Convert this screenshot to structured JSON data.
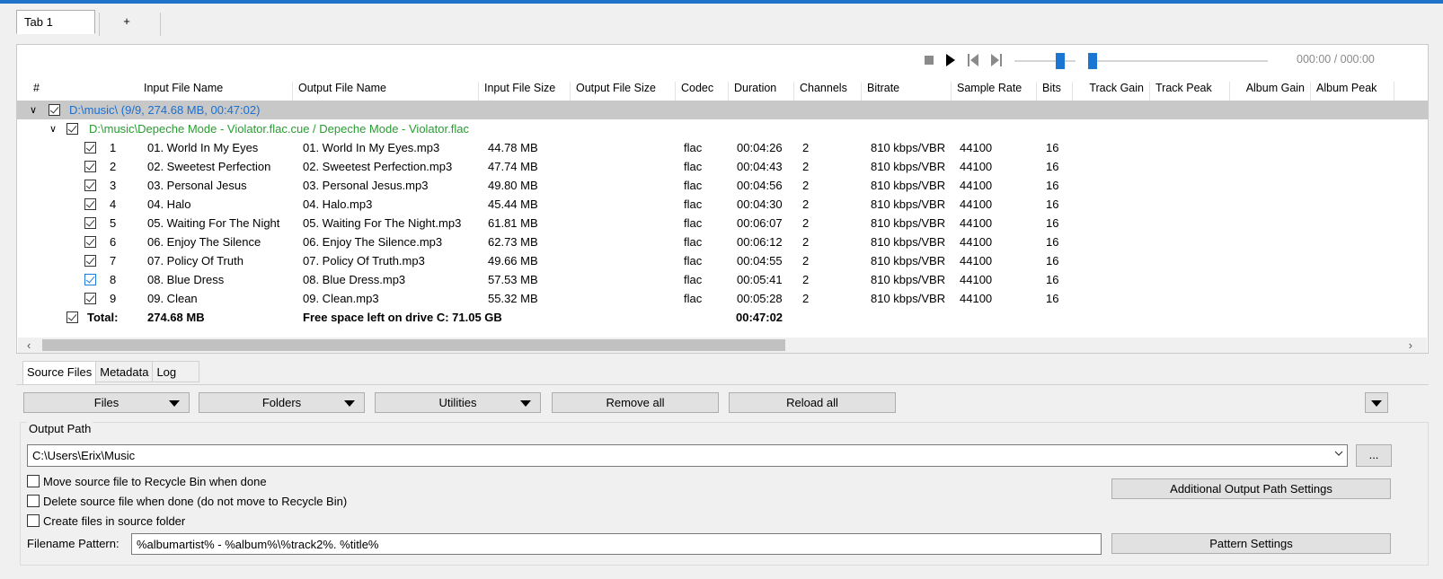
{
  "tabs": [
    "Tab 1",
    "+"
  ],
  "player": {
    "time": "000:00 / 000:00"
  },
  "columns": [
    "#",
    "Input File Name",
    "Output File Name",
    "Input File Size",
    "Output File Size",
    "Codec",
    "Duration",
    "Channels",
    "Bitrate",
    "Sample Rate",
    "Bits",
    "Track Gain",
    "Track Peak",
    "Album Gain",
    "Album Peak"
  ],
  "group": {
    "label": "D:\\music\\ (9/9, 274.68 MB, 00:47:02)"
  },
  "subgroup": {
    "label": "D:\\music\\Depeche Mode - Violator.flac.cue / Depeche Mode - Violator.flac"
  },
  "tracks": [
    {
      "n": "1",
      "in": "01. World In My Eyes",
      "out": "01. World In My Eyes.mp3",
      "size": "44.78 MB",
      "codec": "flac",
      "dur": "00:04:26",
      "ch": "2",
      "br": "810 kbps/VBR",
      "sr": "44100",
      "bits": "16"
    },
    {
      "n": "2",
      "in": "02. Sweetest Perfection",
      "out": "02. Sweetest Perfection.mp3",
      "size": "47.74 MB",
      "codec": "flac",
      "dur": "00:04:43",
      "ch": "2",
      "br": "810 kbps/VBR",
      "sr": "44100",
      "bits": "16"
    },
    {
      "n": "3",
      "in": "03. Personal Jesus",
      "out": "03. Personal Jesus.mp3",
      "size": "49.80 MB",
      "codec": "flac",
      "dur": "00:04:56",
      "ch": "2",
      "br": "810 kbps/VBR",
      "sr": "44100",
      "bits": "16"
    },
    {
      "n": "4",
      "in": "04. Halo",
      "out": "04. Halo.mp3",
      "size": "45.44 MB",
      "codec": "flac",
      "dur": "00:04:30",
      "ch": "2",
      "br": "810 kbps/VBR",
      "sr": "44100",
      "bits": "16"
    },
    {
      "n": "5",
      "in": "05. Waiting For The Night",
      "out": "05. Waiting For The Night.mp3",
      "size": "61.81 MB",
      "codec": "flac",
      "dur": "00:06:07",
      "ch": "2",
      "br": "810 kbps/VBR",
      "sr": "44100",
      "bits": "16"
    },
    {
      "n": "6",
      "in": "06. Enjoy The Silence",
      "out": "06. Enjoy The Silence.mp3",
      "size": "62.73 MB",
      "codec": "flac",
      "dur": "00:06:12",
      "ch": "2",
      "br": "810 kbps/VBR",
      "sr": "44100",
      "bits": "16"
    },
    {
      "n": "7",
      "in": "07. Policy Of Truth",
      "out": "07. Policy Of Truth.mp3",
      "size": "49.66 MB",
      "codec": "flac",
      "dur": "00:04:55",
      "ch": "2",
      "br": "810 kbps/VBR",
      "sr": "44100",
      "bits": "16"
    },
    {
      "n": "8",
      "in": "08. Blue Dress",
      "out": "08. Blue Dress.mp3",
      "size": "57.53 MB",
      "codec": "flac",
      "dur": "00:05:41",
      "ch": "2",
      "br": "810 kbps/VBR",
      "sr": "44100",
      "bits": "16"
    },
    {
      "n": "9",
      "in": "09. Clean",
      "out": "09. Clean.mp3",
      "size": "55.32 MB",
      "codec": "flac",
      "dur": "00:05:28",
      "ch": "2",
      "br": "810 kbps/VBR",
      "sr": "44100",
      "bits": "16"
    }
  ],
  "total": {
    "label": "Total:",
    "size": "274.68 MB",
    "free": "Free space left on drive C: 71.05 GB",
    "duration": "00:47:02"
  },
  "bottom_tabs": [
    "Source Files",
    "Metadata",
    "Log"
  ],
  "buttons": {
    "files": "Files",
    "folders": "Folders",
    "utilities": "Utilities",
    "remove_all": "Remove all",
    "reload_all": "Reload all"
  },
  "output": {
    "group_label": "Output Path",
    "path": "C:\\Users\\Erix\\Music",
    "browse": "...",
    "move_recycle": "Move source file to Recycle Bin when done",
    "delete_source": "Delete source file when done (do not move to Recycle Bin)",
    "create_in_source": "Create files in source folder",
    "additional_settings": "Additional Output Path Settings",
    "pattern_label": "Filename Pattern:",
    "pattern": "%albumartist% - %album%\\%track2%. %title%",
    "pattern_settings": "Pattern Settings"
  },
  "colors": {
    "accent": "#1976d2",
    "group_text": "#1b6fd1",
    "subgroup_text": "#2a9c32"
  }
}
